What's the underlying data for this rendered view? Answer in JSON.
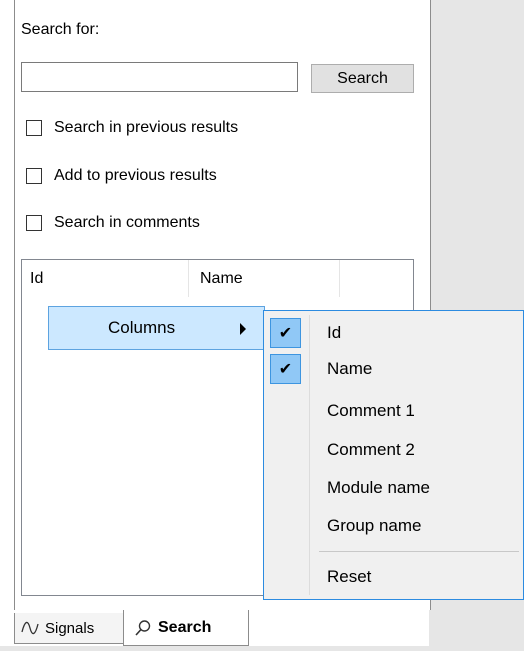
{
  "search_panel": {
    "label": "Search for:",
    "input_value": "",
    "button_label": "Search",
    "options": [
      {
        "label": "Search in previous results",
        "checked": false
      },
      {
        "label": "Add to previous results",
        "checked": false
      },
      {
        "label": "Search in comments",
        "checked": false
      }
    ]
  },
  "results_table": {
    "columns": [
      "Id",
      "Name"
    ]
  },
  "context_menu": {
    "item_label": "Columns"
  },
  "columns_submenu": {
    "items": [
      {
        "label": "Id",
        "checked": true
      },
      {
        "label": "Name",
        "checked": true
      },
      {
        "label": "Comment 1",
        "checked": false
      },
      {
        "label": "Comment 2",
        "checked": false
      },
      {
        "label": "Module name",
        "checked": false
      },
      {
        "label": "Group name",
        "checked": false
      }
    ],
    "reset_label": "Reset",
    "check_glyph": "✔"
  },
  "tabs": [
    {
      "label": "Signals",
      "icon": "waveform-icon",
      "active": false
    },
    {
      "label": "Search",
      "icon": "magnifier-icon",
      "active": true
    }
  ]
}
